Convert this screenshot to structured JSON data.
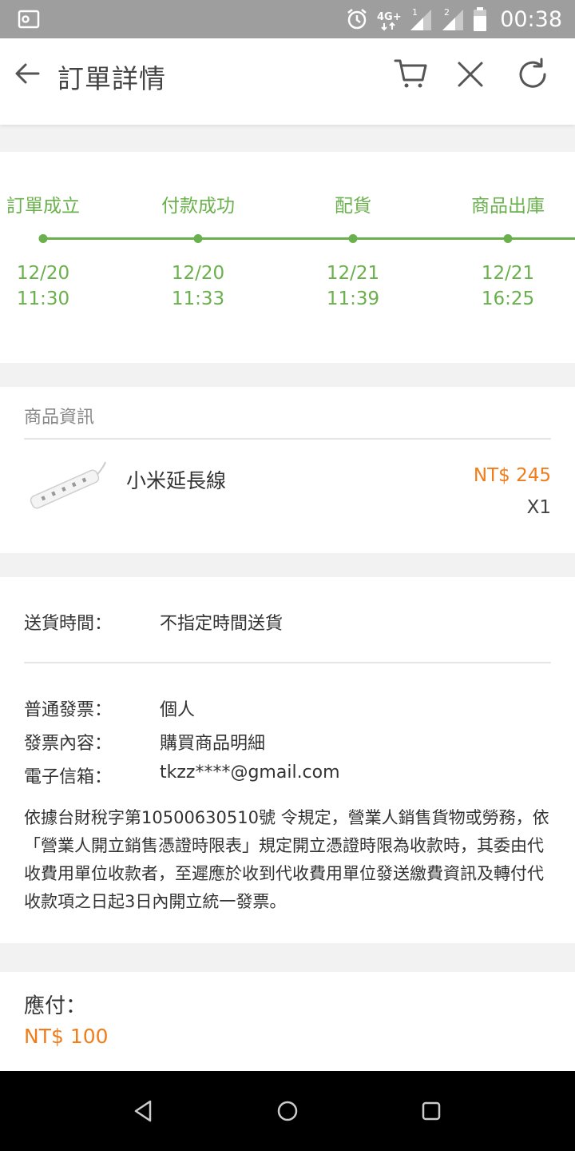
{
  "status_bar": {
    "time": "00:38",
    "icons": [
      "screenshot-icon",
      "alarm-icon",
      "4g-icon",
      "signal-sim1-icon",
      "signal-sim2-icon",
      "battery-icon"
    ]
  },
  "app_bar": {
    "title": "訂單詳情",
    "icons": [
      "back-arrow-icon",
      "cart-icon",
      "close-icon",
      "refresh-icon"
    ]
  },
  "timeline": {
    "steps": [
      {
        "label": "訂單成立",
        "date": "12/20",
        "time": "11:30"
      },
      {
        "label": "付款成功",
        "date": "12/20",
        "time": "11:33"
      },
      {
        "label": "配貨",
        "date": "12/21",
        "time": "11:39"
      },
      {
        "label": "商品出庫",
        "date": "12/21",
        "time": "16:25"
      }
    ]
  },
  "product_section": {
    "title": "商品資訊",
    "product": {
      "name": "小米延長線",
      "price": "NT$ 245",
      "qty": "X1"
    }
  },
  "info_section": {
    "delivery": {
      "label": "送貨時間：",
      "value": "不指定時間送貨"
    },
    "invoice_type": {
      "label": "普通發票：",
      "value": "個人"
    },
    "invoice_content": {
      "label": "發票內容：",
      "value": "購買商品明細"
    },
    "email": {
      "label": "電子信箱：",
      "value": "tkzz****@gmail.com"
    },
    "notice": "依據台財稅字第10500630510號 令規定，營業人銷售貨物或勞務，依「營業人開立銷售憑證時限表」規定開立憑證時限為收款時，其委由代收費用單位收款者，至遲應於收到代收費用單位發送繳費資訊及轉付代收款項之日起3日內開立統一發票。"
  },
  "total": {
    "label": "應付：",
    "value": "NT$ 100"
  },
  "colors": {
    "green": "#6ab04c",
    "orange": "#f07d1a"
  }
}
